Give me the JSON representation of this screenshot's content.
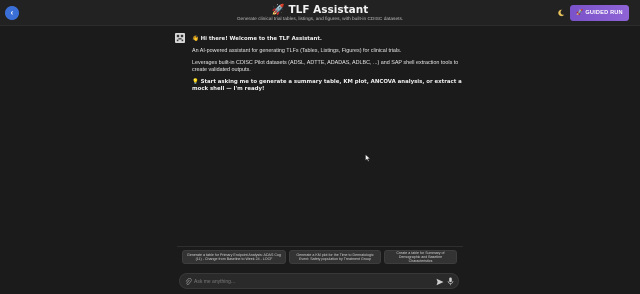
{
  "header": {
    "back_glyph": "‹",
    "title": "🚀 TLF Assistant",
    "subtitle": "Generate clinical trial tables, listings, and figures, with built-in CDISC datasets.",
    "guided_run_label": "GUIDED RUN",
    "guided_run_icon": "🚀"
  },
  "colors": {
    "background": "#1b1b1b",
    "header": "#222222",
    "accent_blue": "#3b6fd8",
    "accent_purple": "#8f63d6"
  },
  "icons": {
    "back": "chevron-left-icon",
    "theme": "moon-icon",
    "avatar": "bot-avatar-icon",
    "attach": "paperclip-icon",
    "send": "send-icon",
    "mic": "microphone-icon"
  },
  "message": {
    "greeting": "👋 Hi there! Welcome to the TLF Assistant.",
    "intro": "An AI-powered assistant for generating TLFs (Tables, Listings, Figures) for clinical trials.",
    "leverages": "Leverages built-in CDISC Pilot datasets (ADSL, ADTTE, ADADAS, ADLBC, ...) and SAP shell extraction tools to create validated outputs.",
    "cta": "💡 Start asking me to generate a summary table, KM plot, ANCOVA analysis, or extract a mock shell — I'm ready!"
  },
  "suggestions": [
    "Generate a table for Primary Endpoint Analysis: ADAS Cog (11) - Change from Baseline to Week 24 - LOCF",
    "Generate a KM plot for the Time to Dermatologic Event: Safety population by Treatment Group",
    "Create a table for Summary of Demographic and Baseline Characteristics"
  ],
  "input": {
    "placeholder": "Ask me anything...",
    "value": ""
  }
}
